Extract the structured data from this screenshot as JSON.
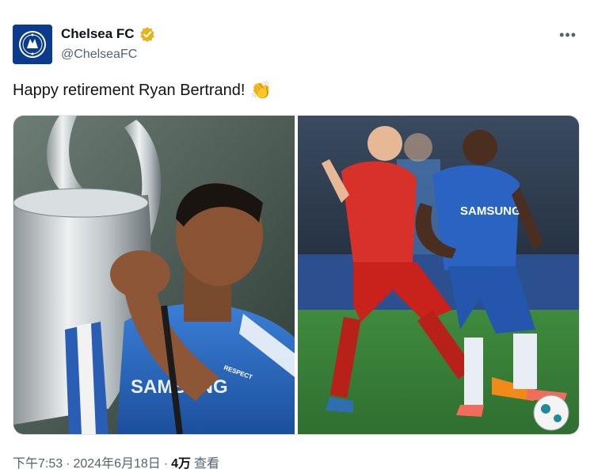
{
  "account": {
    "display_name": "Chelsea FC",
    "handle": "@ChelseaFC",
    "verified_icon": "gold-verified-badge-icon",
    "avatar_icon": "chelsea-crest-icon"
  },
  "tweet": {
    "text": "Happy retirement Ryan Bertrand!",
    "emoji": "👏",
    "more_icon": "more-options-icon"
  },
  "media": {
    "images": [
      {
        "name": "photo-trophy-kiss",
        "jersey_text": "SAMSUNG",
        "sleeve_text": "RESPECT"
      },
      {
        "name": "photo-match-action",
        "jersey_text": "SAMSUNG"
      }
    ]
  },
  "meta": {
    "time": "下午7:53",
    "separator": "·",
    "date": "2024年6月18日",
    "views_count": "4万",
    "views_label": "查看"
  },
  "colors": {
    "chelsea_blue": "#0a3b8c",
    "bayern_red": "#d8312a",
    "verified_gold": "#e8b21a",
    "secondary_text": "#536471"
  }
}
